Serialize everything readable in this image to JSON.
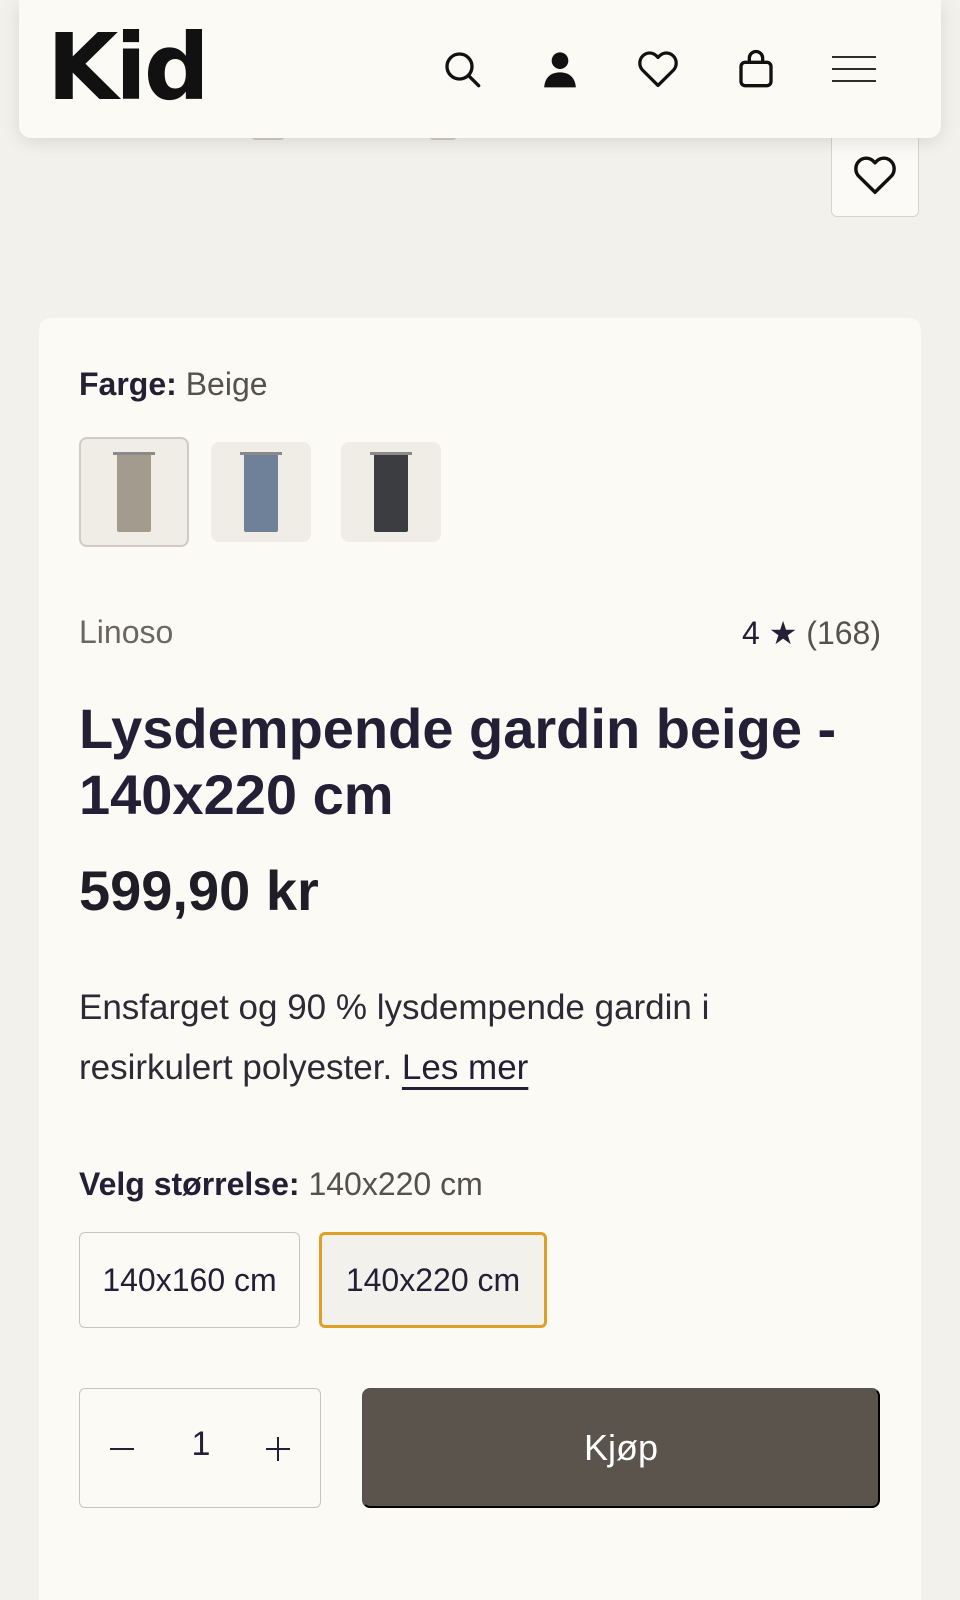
{
  "header": {
    "logo": "Kid"
  },
  "product": {
    "color_label": "Farge:",
    "color_value": "Beige",
    "swatches": [
      {
        "name": "Beige",
        "color": "#a39b8d"
      },
      {
        "name": "Blå",
        "color": "#6f8199"
      },
      {
        "name": "Sort",
        "color": "#3c3d40"
      }
    ],
    "brand": "Linoso",
    "rating_value": "4",
    "rating_star": "★",
    "rating_count": "(168)",
    "title": "Lysdempende gardin beige - 140x220 cm",
    "price": "599,90 kr",
    "description": "Ensfarget og 90 % lysdempende gardin i resirkulert polyester.",
    "read_more": "Les mer",
    "size_label": "Velg størrelse:",
    "size_value": "140x220 cm",
    "sizes": [
      "140x160 cm",
      "140x220 cm"
    ],
    "selected_size_index": 1,
    "quantity": "1",
    "buy_label": "Kjøp"
  },
  "colors": {
    "accent": "#e0a026",
    "buy_button": "#5b544c",
    "background": "#f3f1ec",
    "card": "#fbfaf5"
  }
}
